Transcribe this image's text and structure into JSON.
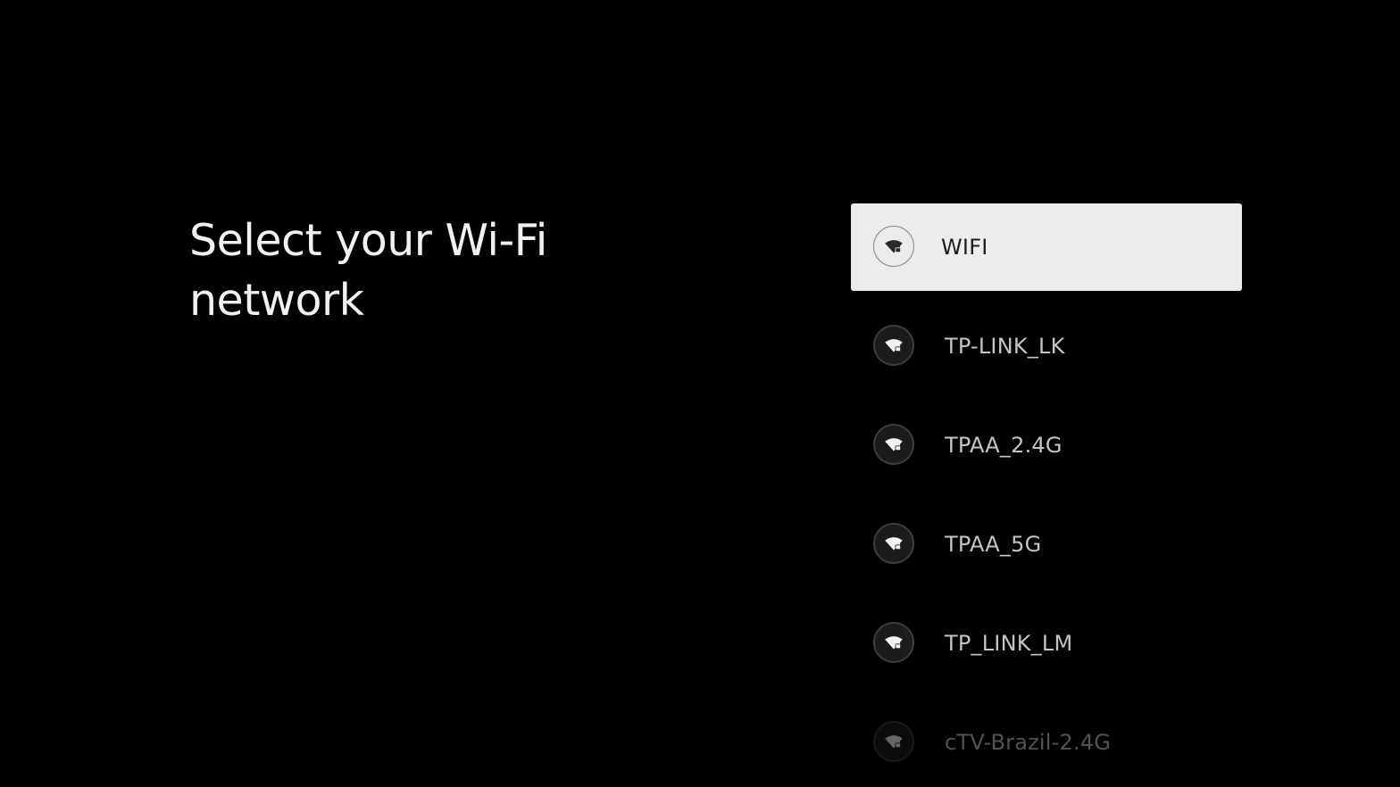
{
  "page": {
    "title": "Select your Wi-Fi network"
  },
  "networks": [
    {
      "ssid": "WIFI",
      "icon": "wifi-lock-icon",
      "focused": true
    },
    {
      "ssid": "TP-LINK_LK",
      "icon": "wifi-lock-icon",
      "focused": false
    },
    {
      "ssid": "TPAA_2.4G",
      "icon": "wifi-lock-icon",
      "focused": false
    },
    {
      "ssid": "TPAA_5G",
      "icon": "wifi-lock-icon",
      "focused": false
    },
    {
      "ssid": "TP_LINK_LM",
      "icon": "wifi-lock-icon",
      "focused": false
    },
    {
      "ssid": "cTV-Brazil-2.4G",
      "icon": "wifi-lock-icon",
      "focused": false
    }
  ],
  "colors": {
    "background": "#000000",
    "focus_background": "#ececec",
    "title_text": "#f1f1f1",
    "item_text": "#c4c4c4",
    "focused_text": "#1e1e1e"
  }
}
